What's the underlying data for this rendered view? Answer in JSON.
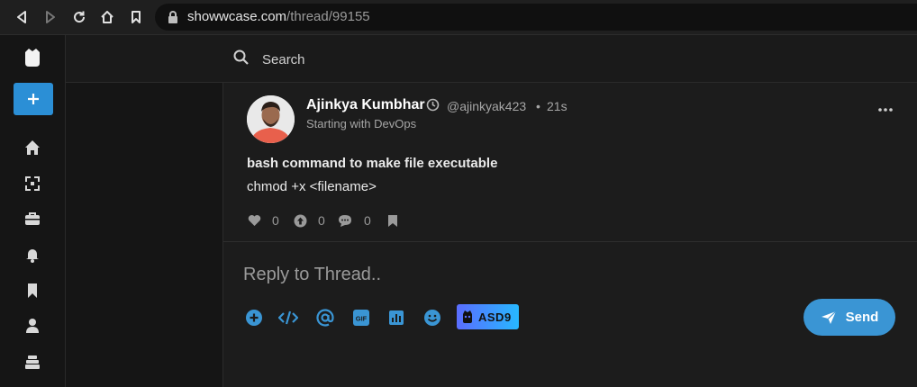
{
  "browser": {
    "url_domain": "showwcase.com",
    "url_path": "/thread/99155"
  },
  "search": {
    "placeholder": "Search"
  },
  "post": {
    "author_name": "Ajinkya Kumbhar",
    "handle": "@ajinkyak423",
    "separator": "•",
    "time_ago": "21s",
    "subtitle": "Starting with DevOps",
    "title": "bash command to make file executable",
    "body": "chmod +x <filename>",
    "likes": "0",
    "boosts": "0",
    "comments": "0"
  },
  "reply": {
    "placeholder": "Reply to Thread..",
    "asd9_label": "ASD9",
    "send_label": "Send"
  },
  "colors": {
    "accent": "#2b8fd6",
    "send": "#3a95d4",
    "background": "#151515",
    "panel": "#1c1c1c"
  },
  "icons": {
    "rail": [
      "logo-icon",
      "plus-icon",
      "home-icon",
      "expand-icon",
      "briefcase-icon",
      "bell-icon",
      "bookmark-icon",
      "user-icon",
      "layers-icon"
    ],
    "toolbar": [
      "add-circle-icon",
      "code-icon",
      "at-icon",
      "gif-icon",
      "bar-chart-icon",
      "emoji-icon"
    ]
  }
}
